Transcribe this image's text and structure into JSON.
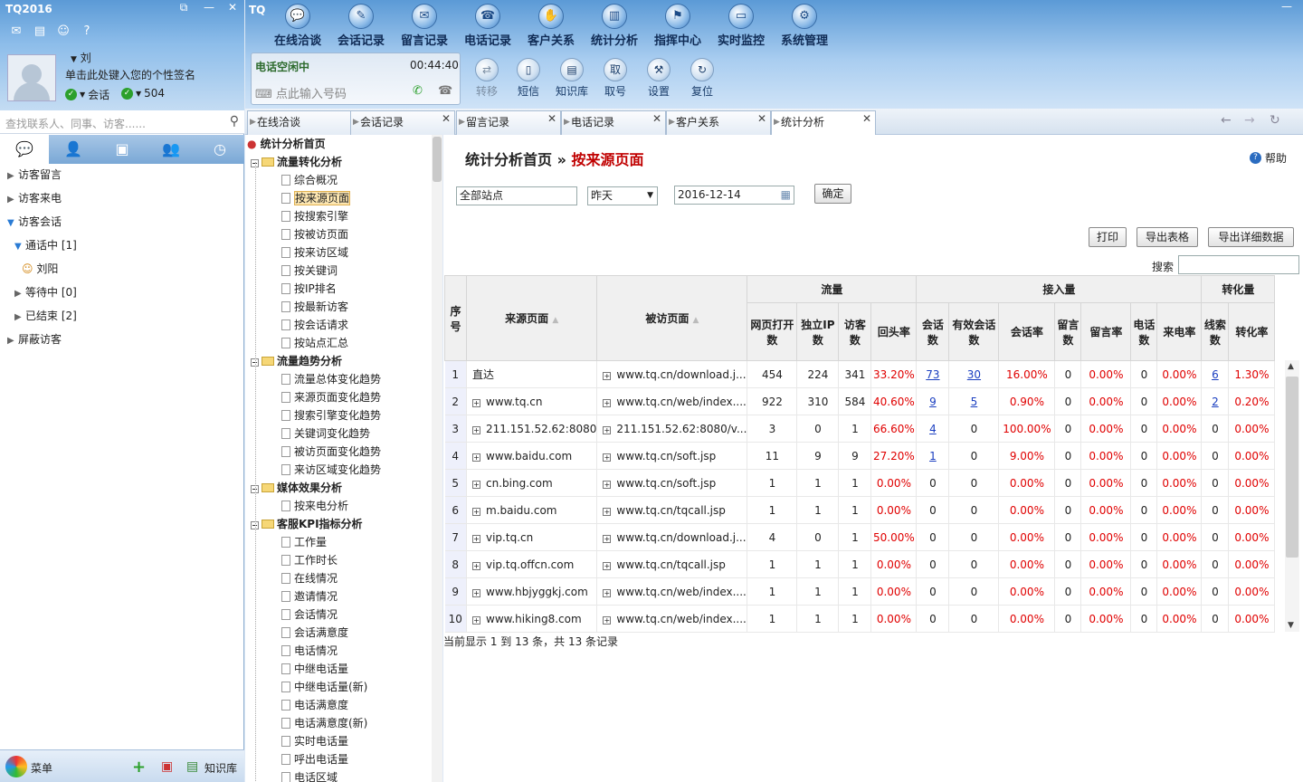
{
  "app": {
    "title": "TQ2016",
    "top_title": "TQ"
  },
  "profile": {
    "name": "刘",
    "signature": "单击此处键入您的个性签名",
    "status1": "会话",
    "status2": "504"
  },
  "search": {
    "placeholder": "查找联系人、同事、访客......"
  },
  "left_tree": [
    {
      "label": "访客留言"
    },
    {
      "label": "访客来电"
    },
    {
      "label": "访客会话"
    },
    {
      "label": "通话中  [1]"
    },
    {
      "label": "刘阳"
    },
    {
      "label": "等待中  [0]"
    },
    {
      "label": "已结束  [2]"
    },
    {
      "label": "屏蔽访客"
    }
  ],
  "left_footer": {
    "menu": "菜单",
    "kb": "知识库"
  },
  "nav": [
    "在线洽谈",
    "会话记录",
    "留言记录",
    "电话记录",
    "客户关系",
    "统计分析",
    "指挥中心",
    "实时监控",
    "系统管理"
  ],
  "phone": {
    "status": "电话空闲中",
    "time": "00:44:40",
    "placeholder": "点此输入号码"
  },
  "tools": [
    "转移",
    "短信",
    "知识库",
    "取号",
    "设置",
    "复位"
  ],
  "tabs": [
    "在线洽谈",
    "会话记录",
    "留言记录",
    "电话记录",
    "客户关系",
    "统计分析"
  ],
  "tree": {
    "root": "统计分析首页",
    "g1": "流量转化分析",
    "g1_items": [
      "综合概况",
      "按来源页面",
      "按搜索引擎",
      "按被访页面",
      "按来访区域",
      "按关键词",
      "按IP排名",
      "按最新访客",
      "按会话请求",
      "按站点汇总"
    ],
    "g2": "流量趋势分析",
    "g2_items": [
      "流量总体变化趋势",
      "来源页面变化趋势",
      "搜索引擎变化趋势",
      "关键词变化趋势",
      "被访页面变化趋势",
      "来访区域变化趋势"
    ],
    "g3": "媒体效果分析",
    "g3_items": [
      "按来电分析"
    ],
    "g4": "客服KPI指标分析",
    "g4_items": [
      "工作量",
      "工作时长",
      "在线情况",
      "邀请情况",
      "会话情况",
      "会话满意度",
      "电话情况",
      "中继电话量",
      "中继电话量(新)",
      "电话满意度",
      "电话满意度(新)",
      "实时电话量",
      "呼出电话量",
      "电话区域"
    ]
  },
  "main": {
    "crumb_home": "统计分析首页",
    "crumb_sep": "»",
    "crumb_current": "按来源页面",
    "help": "帮助",
    "site": "全部站点",
    "period": "昨天",
    "date": "2016-12-14",
    "ok": "确定",
    "print": "打印",
    "export": "导出表格",
    "export_detail": "导出详细数据",
    "search_label": "搜索",
    "footer": "当前显示 1 到 13 条，共 13 条记录"
  },
  "table": {
    "groups": {
      "traffic": "流量",
      "access": "接入量",
      "conv": "转化量"
    },
    "headers": [
      "序号",
      "来源页面",
      "被访页面",
      "网页打开数",
      "独立IP数",
      "访客数",
      "回头率",
      "会话数",
      "有效会话数",
      "会话率",
      "留言数",
      "留言率",
      "电话数",
      "来电率",
      "线索数",
      "转化率"
    ],
    "rows": [
      [
        "1",
        "直达",
        "www.tq.cn/download.j...",
        "454",
        "224",
        "341",
        "33.20%",
        "73",
        "30",
        "16.00%",
        "0",
        "0.00%",
        "0",
        "0.00%",
        "6",
        "1.30%"
      ],
      [
        "2",
        "www.tq.cn",
        "www.tq.cn/web/index....",
        "922",
        "310",
        "584",
        "40.60%",
        "9",
        "5",
        "0.90%",
        "0",
        "0.00%",
        "0",
        "0.00%",
        "2",
        "0.20%"
      ],
      [
        "3",
        "211.151.52.62:8080",
        "211.151.52.62:8080/v...",
        "3",
        "0",
        "1",
        "66.60%",
        "4",
        "0",
        "100.00%",
        "0",
        "0.00%",
        "0",
        "0.00%",
        "0",
        "0.00%"
      ],
      [
        "4",
        "www.baidu.com",
        "www.tq.cn/soft.jsp",
        "11",
        "9",
        "9",
        "27.20%",
        "1",
        "0",
        "9.00%",
        "0",
        "0.00%",
        "0",
        "0.00%",
        "0",
        "0.00%"
      ],
      [
        "5",
        "cn.bing.com",
        "www.tq.cn/soft.jsp",
        "1",
        "1",
        "1",
        "0.00%",
        "0",
        "0",
        "0.00%",
        "0",
        "0.00%",
        "0",
        "0.00%",
        "0",
        "0.00%"
      ],
      [
        "6",
        "m.baidu.com",
        "www.tq.cn/tqcall.jsp",
        "1",
        "1",
        "1",
        "0.00%",
        "0",
        "0",
        "0.00%",
        "0",
        "0.00%",
        "0",
        "0.00%",
        "0",
        "0.00%"
      ],
      [
        "7",
        "vip.tq.cn",
        "www.tq.cn/download.j...",
        "4",
        "0",
        "1",
        "50.00%",
        "0",
        "0",
        "0.00%",
        "0",
        "0.00%",
        "0",
        "0.00%",
        "0",
        "0.00%"
      ],
      [
        "8",
        "vip.tq.offcn.com",
        "www.tq.cn/tqcall.jsp",
        "1",
        "1",
        "1",
        "0.00%",
        "0",
        "0",
        "0.00%",
        "0",
        "0.00%",
        "0",
        "0.00%",
        "0",
        "0.00%"
      ],
      [
        "9",
        "www.hbjyggkj.com",
        "www.tq.cn/web/index....",
        "1",
        "1",
        "1",
        "0.00%",
        "0",
        "0",
        "0.00%",
        "0",
        "0.00%",
        "0",
        "0.00%",
        "0",
        "0.00%"
      ],
      [
        "10",
        "www.hiking8.com",
        "www.tq.cn/web/index....",
        "1",
        "1",
        "1",
        "0.00%",
        "0",
        "0",
        "0.00%",
        "0",
        "0.00%",
        "0",
        "0.00%",
        "0",
        "0.00%"
      ]
    ]
  },
  "colors": {
    "accent": "#5b9ad6",
    "red": "#c00000",
    "link": "#1a3ec0"
  }
}
